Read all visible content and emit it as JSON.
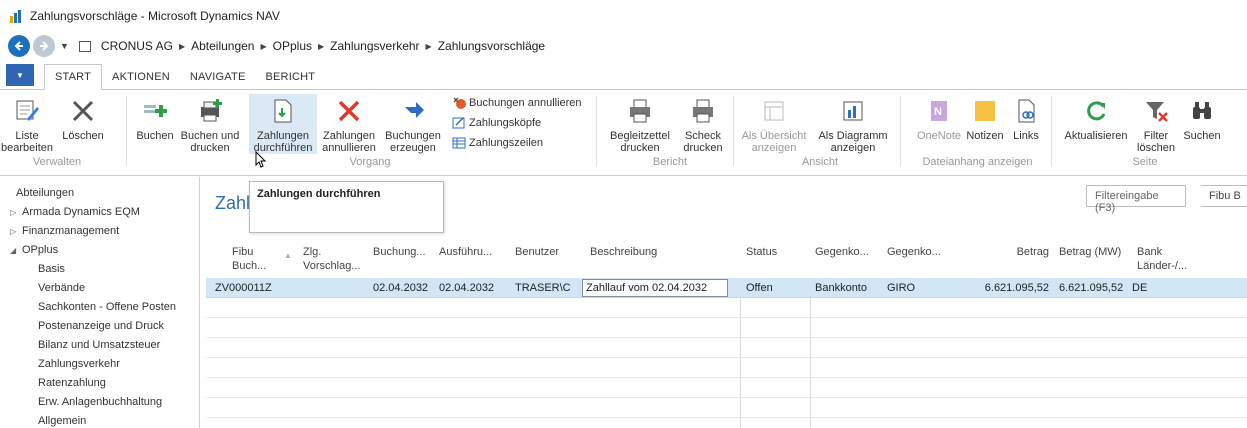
{
  "window": {
    "title": "Zahlungsvorschläge - Microsoft Dynamics NAV"
  },
  "breadcrumb": [
    "CRONUS AG",
    "Abteilungen",
    "OPplus",
    "Zahlungsverkehr",
    "Zahlungsvorschläge"
  ],
  "ribbon_tabs": [
    "START",
    "AKTIONEN",
    "NAVIGATE",
    "BERICHT"
  ],
  "ribbon": {
    "liste_bearbeiten": "Liste\nbearbeiten",
    "loeschen": "Löschen",
    "buchen": "Buchen",
    "buchen_drucken": "Buchen und\ndrucken",
    "zahlungen_durchfuehren": "Zahlungen\ndurchführen",
    "zahlungen_annullieren": "Zahlungen\nannullieren",
    "buchungen_erzeugen": "Buchungen\nerzeugen",
    "buchungen_annullieren": "Buchungen annullieren",
    "zahlungskoepfe": "Zahlungsköpfe",
    "zahlungszeilen": "Zahlungszeilen",
    "begleitzettel": "Begleitzettel\ndrucken",
    "scheck": "Scheck\ndrucken",
    "als_uebersicht": "Als Übersicht\nanzeigen",
    "als_diagramm": "Als Diagramm\nanzeigen",
    "onenote": "OneNote",
    "notizen": "Notizen",
    "links": "Links",
    "aktualisieren": "Aktualisieren",
    "filter_loeschen": "Filter\nlöschen",
    "suchen": "Suchen",
    "groups": {
      "verwalten": "Verwalten",
      "vorgang": "Vorgang",
      "bericht": "Bericht",
      "ansicht": "Ansicht",
      "dateianhang": "Dateianhang anzeigen",
      "seite": "Seite"
    }
  },
  "nav": {
    "items": [
      {
        "label": "Abteilungen",
        "arrow": ""
      },
      {
        "label": "Armada Dynamics EQM",
        "arrow": "▷"
      },
      {
        "label": "Finanzmanagement",
        "arrow": "▷"
      },
      {
        "label": "OPplus",
        "arrow": "◢"
      },
      {
        "label": "Basis",
        "arrow": ""
      },
      {
        "label": "Verbände",
        "arrow": ""
      },
      {
        "label": "Sachkonten - Offene Posten",
        "arrow": ""
      },
      {
        "label": "Postenanzeige und Druck",
        "arrow": ""
      },
      {
        "label": "Bilanz und Umsatzsteuer",
        "arrow": ""
      },
      {
        "label": "Zahlungsverkehr",
        "arrow": ""
      },
      {
        "label": "Ratenzahlung",
        "arrow": ""
      },
      {
        "label": "Erw. Anlagenbuchhaltung",
        "arrow": ""
      },
      {
        "label": "Allgemein",
        "arrow": ""
      }
    ]
  },
  "page": {
    "title": "Zahl",
    "tooltip": "Zahlungen durchführen",
    "filter_placeholder": "Filtereingabe (F3)",
    "filter_field": "Fibu B"
  },
  "table": {
    "headers": {
      "fibu": "Fibu\nBuch...",
      "zlg": "Zlg.\nVorschlag...",
      "buchung": "Buchung...",
      "ausfuehr": "Ausführu...",
      "benutzer": "Benutzer",
      "beschreibung": "Beschreibung",
      "status": "Status",
      "gegenko1": "Gegenko...",
      "gegenko2": "Gegenko...",
      "betrag": "Betrag",
      "betrag_mw": "Betrag (MW)",
      "bank": "Bank\nLänder-/..."
    },
    "rows": [
      {
        "fibu": "ZV000011Z",
        "zlg": "",
        "buchung": "02.04.2032",
        "ausfuehr": "02.04.2032",
        "benutzer": "TRASER\\C",
        "beschreibung": "Zahllauf vom 02.04.2032",
        "status": "Offen",
        "gegenko1": "Bankkonto",
        "gegenko2": "GIRO",
        "betrag": "6.621.095,52",
        "betrag_mw": "6.621.095,52",
        "bank": "DE"
      }
    ]
  },
  "colors": {
    "accent": "#2e6db1",
    "selected_row": "#d3e6f7"
  }
}
